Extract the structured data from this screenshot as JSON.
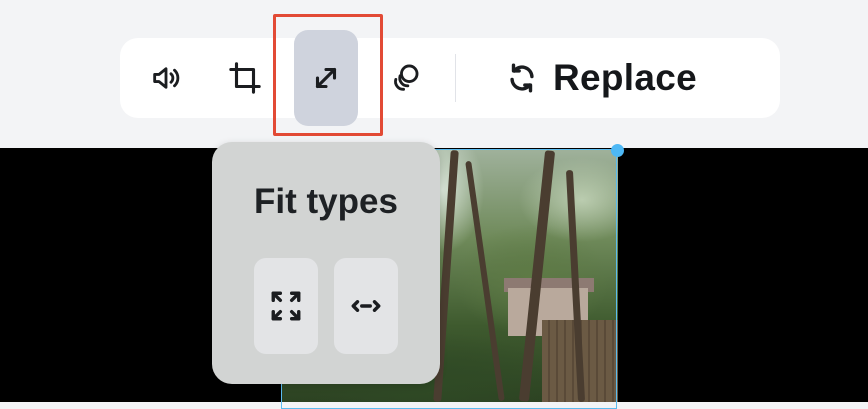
{
  "toolbar": {
    "buttons": [
      {
        "name": "volume-icon"
      },
      {
        "name": "crop-icon"
      },
      {
        "name": "fit-expand-icon",
        "active": true
      },
      {
        "name": "effects-circles-icon"
      }
    ],
    "replace": {
      "label": "Replace",
      "icon": "refresh-icon"
    }
  },
  "popover": {
    "title": "Fit types",
    "options": [
      {
        "icon": "fit-fill-icon"
      },
      {
        "icon": "fit-width-icon"
      }
    ]
  },
  "colors": {
    "highlight": "#e24a35",
    "selection": "#5bbcf0",
    "active_pill": "#cfd3dd"
  }
}
